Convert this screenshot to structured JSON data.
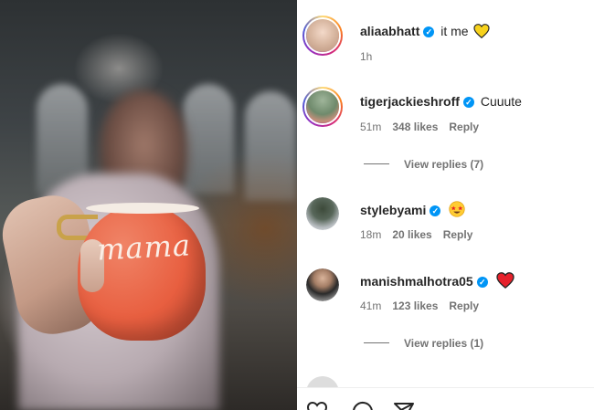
{
  "photo": {
    "mug_text": "mama"
  },
  "comments": [
    {
      "username": "aliaabhatt",
      "verified": true,
      "text": "it me",
      "emoji": "yellow-heart",
      "time": "1h",
      "likes": "",
      "reply": ""
    },
    {
      "username": "tigerjackieshroff",
      "verified": true,
      "text": "Cuuute",
      "emoji": "",
      "time": "51m",
      "likes": "348 likes",
      "reply": "Reply",
      "view_replies": "View replies (7)"
    },
    {
      "username": "stylebyami",
      "verified": true,
      "text": "",
      "emoji": "star-struck",
      "time": "18m",
      "likes": "20 likes",
      "reply": "Reply"
    },
    {
      "username": "manishmalhotra05",
      "verified": true,
      "text": "",
      "emoji": "red-heart",
      "time": "41m",
      "likes": "123 likes",
      "reply": "Reply",
      "view_replies": "View replies (1)"
    }
  ],
  "icons": {
    "verified": "verified-badge-icon",
    "like": "heart-icon",
    "comment": "comment-icon",
    "share": "share-icon"
  },
  "colors": {
    "verified_blue": "#0095f6",
    "meta_gray": "#737373",
    "text": "#262626",
    "mug_orange": "#e85f40"
  }
}
